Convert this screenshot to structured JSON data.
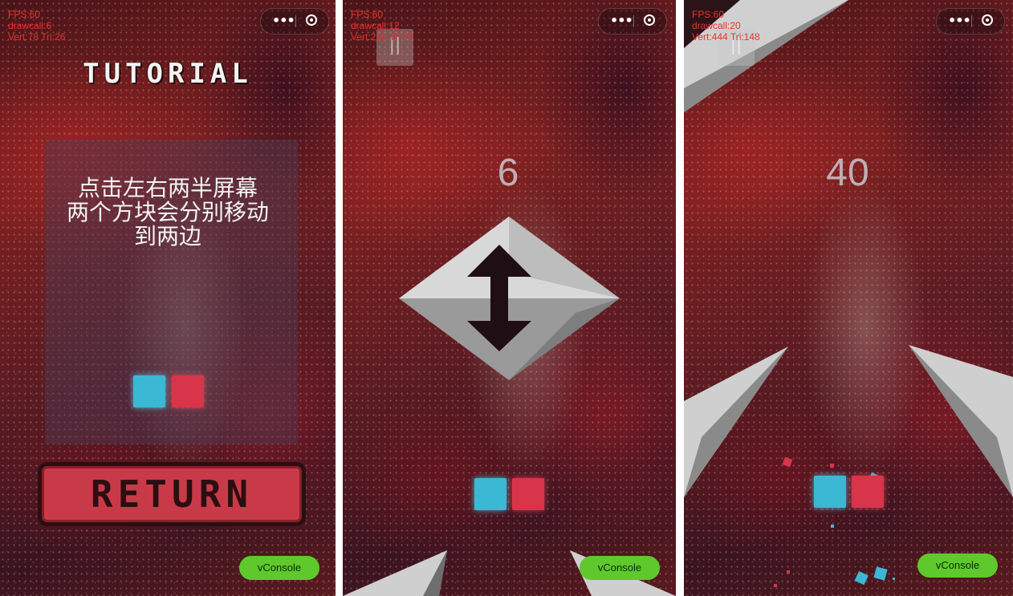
{
  "panels": [
    {
      "stats": {
        "fps": "FPS:60",
        "drawcall": "drawcall:6",
        "vert": "Vert:78 Tri:26"
      },
      "title": "TUTORIAL",
      "instructions": [
        "点击左右两半屏幕",
        "两个方块会分别移动",
        "到两边"
      ],
      "return_label": "RETURN",
      "vconsole_label": "vConsole"
    },
    {
      "stats": {
        "fps": "FPS:60",
        "drawcall": "drawcall:12",
        "vert": "Vert:218 Tri:76"
      },
      "score": "6",
      "pause_glyph": "||",
      "vconsole_label": "vConsole"
    },
    {
      "stats": {
        "fps": "FPS:60",
        "drawcall": "drawcall:20",
        "vert": "Vert:444 Tri:148"
      },
      "score": "40",
      "pause_glyph": "||",
      "vconsole_label": "vConsole"
    }
  ],
  "colors": {
    "blue_block": "#3ab8d4",
    "red_block": "#d8344a",
    "vconsole": "#5ec82c",
    "stats_text": "#e8322e"
  },
  "capsule_icons": [
    "more-icon",
    "target-icon"
  ]
}
